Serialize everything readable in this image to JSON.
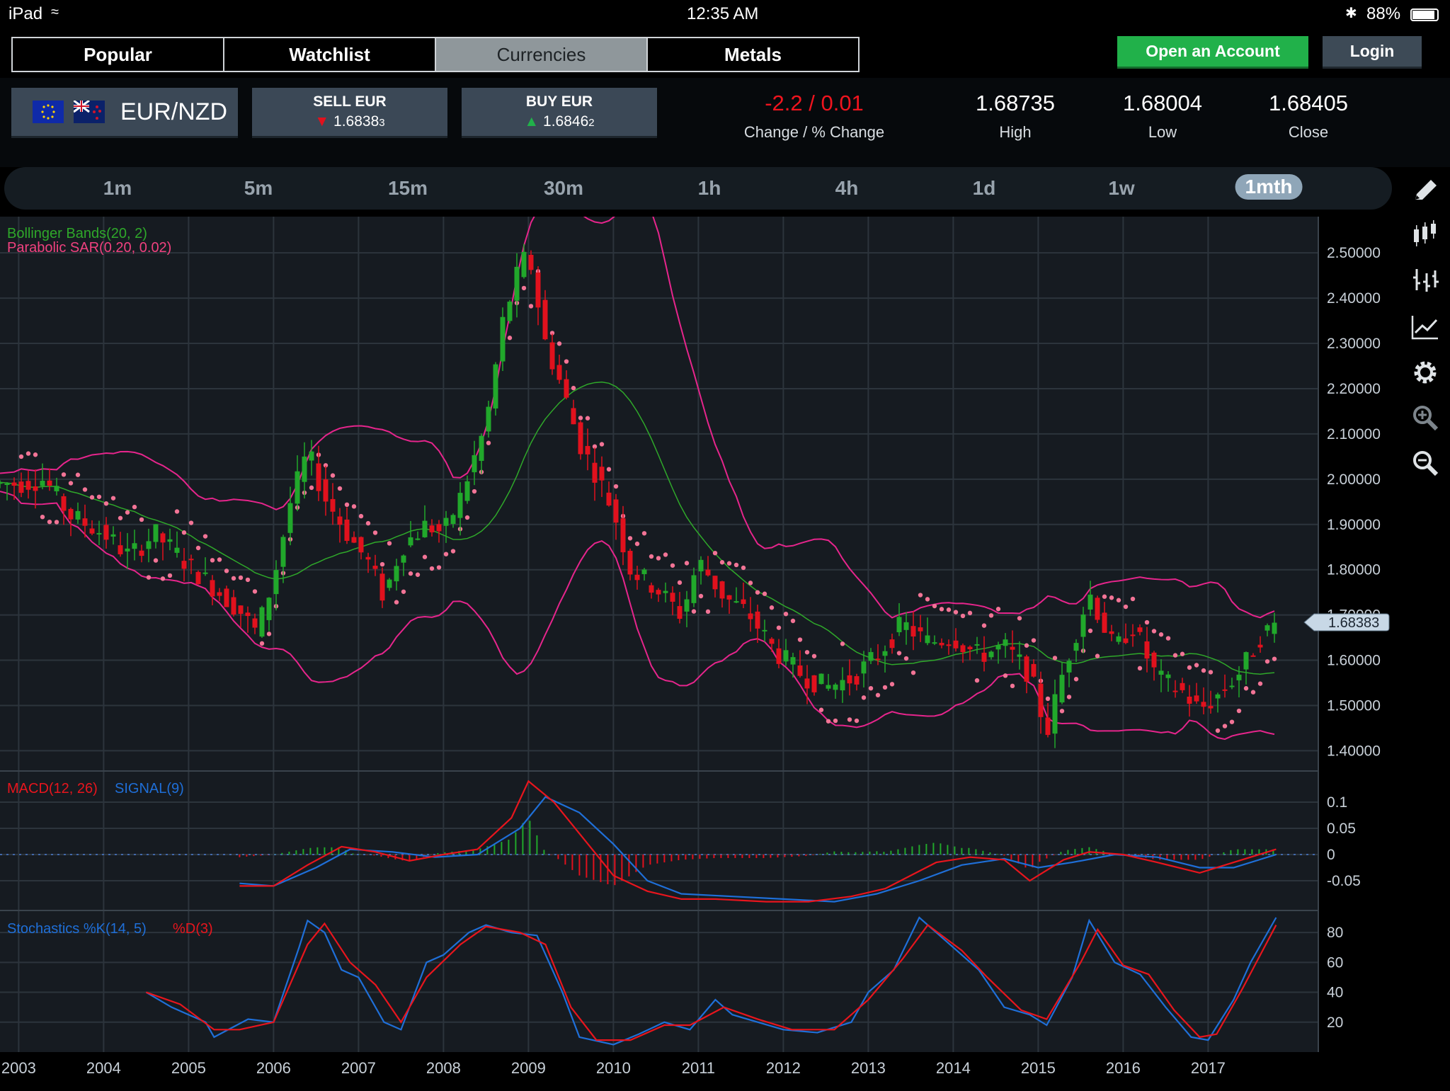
{
  "status_bar": {
    "device": "iPad",
    "time": "12:35 AM",
    "battery": "88%"
  },
  "nav_tabs": [
    {
      "label": "Popular",
      "active": false
    },
    {
      "label": "Watchlist",
      "active": false
    },
    {
      "label": "Currencies",
      "active": true
    },
    {
      "label": "Metals",
      "active": false
    }
  ],
  "account": {
    "open_label": "Open an Account",
    "login_label": "Login"
  },
  "instrument": {
    "pair": "EUR/NZD",
    "flags": [
      "eu-flag-icon",
      "nz-flag-icon"
    ]
  },
  "sell": {
    "label": "SELL EUR",
    "price": "1.6838",
    "price_small": "3"
  },
  "buy": {
    "label": "BUY EUR",
    "price": "1.6846",
    "price_small": "2"
  },
  "stats": {
    "change": {
      "value": "-2.2 / 0.01",
      "label": "Change / % Change"
    },
    "high": {
      "value": "1.68735",
      "label": "High"
    },
    "low": {
      "value": "1.68004",
      "label": "Low"
    },
    "close": {
      "value": "1.68405",
      "label": "Close"
    }
  },
  "timeframes": [
    "1m",
    "5m",
    "15m",
    "30m",
    "1h",
    "4h",
    "1d",
    "1w",
    "1mth"
  ],
  "active_timeframe": "1mth",
  "tools": [
    "pencil-icon",
    "candlestick-icon",
    "ohlc-bars-icon",
    "line-chart-icon",
    "gear-icon",
    "zoom-in-icon",
    "zoom-out-icon"
  ],
  "colors": {
    "up": "#21a82b",
    "down": "#e1111d",
    "bollinger": "#e6258c",
    "bollinger_mid": "#2fa82a",
    "sar": "#f27496",
    "macd": "#e8151d",
    "signal": "#1f6fd8",
    "grid": "#2c343c",
    "accent_green": "#21b14a"
  },
  "chart_data": {
    "type": "candlestick",
    "indicators_label": {
      "bollinger": "Bollinger Bands(20, 2)",
      "sar": "Parabolic SAR(0.20, 0.02)"
    },
    "x_ticks": [
      "2003",
      "2004",
      "2005",
      "2006",
      "2007",
      "2008",
      "2009",
      "2010",
      "2011",
      "2012",
      "2013",
      "2014",
      "2015",
      "2016",
      "2017"
    ],
    "y_ticks": [
      "2.50000",
      "2.40000",
      "2.30000",
      "2.20000",
      "2.10000",
      "2.00000",
      "1.90000",
      "1.80000",
      "1.70000",
      "1.60000",
      "1.50000",
      "1.40000"
    ],
    "ylim": [
      1.36,
      2.58
    ],
    "current_price": "1.68383",
    "price_path": [
      [
        2003.0,
        1.99
      ],
      [
        2003.3,
        2.0
      ],
      [
        2003.6,
        1.92
      ],
      [
        2004.0,
        1.88
      ],
      [
        2004.3,
        1.83
      ],
      [
        2004.6,
        1.88
      ],
      [
        2005.0,
        1.81
      ],
      [
        2005.3,
        1.76
      ],
      [
        2005.6,
        1.71
      ],
      [
        2005.8,
        1.66
      ],
      [
        2006.0,
        1.78
      ],
      [
        2006.2,
        1.95
      ],
      [
        2006.4,
        2.06
      ],
      [
        2006.6,
        1.96
      ],
      [
        2006.9,
        1.87
      ],
      [
        2007.1,
        1.82
      ],
      [
        2007.3,
        1.74
      ],
      [
        2007.5,
        1.85
      ],
      [
        2007.8,
        1.9
      ],
      [
        2008.0,
        1.88
      ],
      [
        2008.2,
        1.96
      ],
      [
        2008.5,
        2.12
      ],
      [
        2008.7,
        2.35
      ],
      [
        2008.9,
        2.47
      ],
      [
        2009.0,
        2.5
      ],
      [
        2009.2,
        2.3
      ],
      [
        2009.4,
        2.2
      ],
      [
        2009.6,
        2.08
      ],
      [
        2009.8,
        2.01
      ],
      [
        2010.0,
        1.93
      ],
      [
        2010.2,
        1.8
      ],
      [
        2010.5,
        1.76
      ],
      [
        2010.8,
        1.7
      ],
      [
        2011.0,
        1.82
      ],
      [
        2011.3,
        1.74
      ],
      [
        2011.6,
        1.7
      ],
      [
        2011.9,
        1.62
      ],
      [
        2012.2,
        1.57
      ],
      [
        2012.5,
        1.54
      ],
      [
        2012.8,
        1.56
      ],
      [
        2013.1,
        1.61
      ],
      [
        2013.4,
        1.68
      ],
      [
        2013.7,
        1.64
      ],
      [
        2014.0,
        1.65
      ],
      [
        2014.3,
        1.61
      ],
      [
        2014.6,
        1.63
      ],
      [
        2014.9,
        1.57
      ],
      [
        2015.1,
        1.44
      ],
      [
        2015.3,
        1.58
      ],
      [
        2015.6,
        1.75
      ],
      [
        2015.9,
        1.62
      ],
      [
        2016.1,
        1.68
      ],
      [
        2016.4,
        1.56
      ],
      [
        2016.7,
        1.53
      ],
      [
        2016.9,
        1.49
      ],
      [
        2017.1,
        1.52
      ],
      [
        2017.4,
        1.58
      ],
      [
        2017.6,
        1.65
      ],
      [
        2017.8,
        1.68
      ]
    ],
    "macd_label": {
      "macd": "MACD(12, 26)",
      "signal": "SIGNAL(9)"
    },
    "macd_ticks": [
      "0.1",
      "0.05",
      "0",
      "-0.05"
    ],
    "macd_ylim": [
      -0.1,
      0.15
    ],
    "macd": [
      [
        2005.6,
        -0.06
      ],
      [
        2006.0,
        -0.06
      ],
      [
        2006.4,
        -0.02
      ],
      [
        2006.8,
        0.015
      ],
      [
        2007.2,
        0.005
      ],
      [
        2007.6,
        -0.012
      ],
      [
        2008.0,
        0.0
      ],
      [
        2008.4,
        0.01
      ],
      [
        2008.8,
        0.07
      ],
      [
        2009.0,
        0.14
      ],
      [
        2009.3,
        0.1
      ],
      [
        2009.7,
        0.02
      ],
      [
        2010.0,
        -0.04
      ],
      [
        2010.4,
        -0.07
      ],
      [
        2010.8,
        -0.085
      ],
      [
        2011.2,
        -0.085
      ],
      [
        2011.8,
        -0.09
      ],
      [
        2012.3,
        -0.09
      ],
      [
        2012.8,
        -0.08
      ],
      [
        2013.2,
        -0.065
      ],
      [
        2013.8,
        -0.015
      ],
      [
        2014.2,
        -0.005
      ],
      [
        2014.6,
        -0.01
      ],
      [
        2014.9,
        -0.05
      ],
      [
        2015.3,
        -0.01
      ],
      [
        2015.6,
        0.005
      ],
      [
        2016.0,
        0.0
      ],
      [
        2016.4,
        -0.015
      ],
      [
        2016.9,
        -0.035
      ],
      [
        2017.3,
        -0.015
      ],
      [
        2017.8,
        0.01
      ]
    ],
    "signal": [
      [
        2005.6,
        -0.055
      ],
      [
        2006.0,
        -0.06
      ],
      [
        2006.5,
        -0.025
      ],
      [
        2006.9,
        0.01
      ],
      [
        2007.4,
        0.005
      ],
      [
        2007.9,
        -0.005
      ],
      [
        2008.4,
        0.0
      ],
      [
        2008.9,
        0.05
      ],
      [
        2009.2,
        0.11
      ],
      [
        2009.6,
        0.08
      ],
      [
        2010.0,
        0.02
      ],
      [
        2010.4,
        -0.05
      ],
      [
        2010.8,
        -0.075
      ],
      [
        2011.4,
        -0.08
      ],
      [
        2012.0,
        -0.085
      ],
      [
        2012.6,
        -0.09
      ],
      [
        2013.1,
        -0.075
      ],
      [
        2013.6,
        -0.05
      ],
      [
        2014.1,
        -0.02
      ],
      [
        2014.6,
        -0.008
      ],
      [
        2015.0,
        -0.025
      ],
      [
        2015.4,
        -0.015
      ],
      [
        2015.9,
        0.0
      ],
      [
        2016.4,
        -0.005
      ],
      [
        2016.9,
        -0.025
      ],
      [
        2017.3,
        -0.025
      ],
      [
        2017.8,
        0.0
      ]
    ],
    "stoch_label": {
      "k": "Stochastics %K(14, 5)",
      "d": "%D(3)"
    },
    "stoch_ticks": [
      "80",
      "60",
      "40",
      "20"
    ],
    "stoch_ylim": [
      0,
      90
    ],
    "stoch_k": [
      [
        2004.5,
        40
      ],
      [
        2004.8,
        30
      ],
      [
        2005.2,
        20
      ],
      [
        2005.3,
        10
      ],
      [
        2005.7,
        22
      ],
      [
        2006.0,
        20
      ],
      [
        2006.3,
        70
      ],
      [
        2006.4,
        88
      ],
      [
        2006.6,
        80
      ],
      [
        2006.8,
        55
      ],
      [
        2007.0,
        50
      ],
      [
        2007.3,
        20
      ],
      [
        2007.5,
        15
      ],
      [
        2007.8,
        60
      ],
      [
        2008.0,
        65
      ],
      [
        2008.3,
        80
      ],
      [
        2008.5,
        85
      ],
      [
        2008.8,
        80
      ],
      [
        2009.1,
        78
      ],
      [
        2009.4,
        40
      ],
      [
        2009.6,
        10
      ],
      [
        2010.0,
        5
      ],
      [
        2010.3,
        12
      ],
      [
        2010.6,
        20
      ],
      [
        2010.9,
        15
      ],
      [
        2011.2,
        35
      ],
      [
        2011.4,
        25
      ],
      [
        2011.7,
        20
      ],
      [
        2012.0,
        15
      ],
      [
        2012.4,
        13
      ],
      [
        2012.8,
        20
      ],
      [
        2013.0,
        40
      ],
      [
        2013.3,
        55
      ],
      [
        2013.6,
        90
      ],
      [
        2014.0,
        70
      ],
      [
        2014.3,
        55
      ],
      [
        2014.6,
        30
      ],
      [
        2014.9,
        25
      ],
      [
        2015.1,
        18
      ],
      [
        2015.4,
        50
      ],
      [
        2015.6,
        88
      ],
      [
        2015.9,
        60
      ],
      [
        2016.2,
        52
      ],
      [
        2016.5,
        30
      ],
      [
        2016.8,
        10
      ],
      [
        2017.0,
        8
      ],
      [
        2017.3,
        35
      ],
      [
        2017.5,
        60
      ],
      [
        2017.8,
        90
      ]
    ],
    "stoch_d": [
      [
        2004.5,
        40
      ],
      [
        2004.9,
        32
      ],
      [
        2005.3,
        15
      ],
      [
        2005.6,
        15
      ],
      [
        2006.0,
        20
      ],
      [
        2006.4,
        72
      ],
      [
        2006.6,
        86
      ],
      [
        2006.9,
        60
      ],
      [
        2007.2,
        45
      ],
      [
        2007.5,
        20
      ],
      [
        2007.8,
        50
      ],
      [
        2008.2,
        72
      ],
      [
        2008.5,
        84
      ],
      [
        2008.9,
        80
      ],
      [
        2009.2,
        72
      ],
      [
        2009.5,
        30
      ],
      [
        2009.8,
        8
      ],
      [
        2010.2,
        8
      ],
      [
        2010.6,
        18
      ],
      [
        2010.9,
        18
      ],
      [
        2011.3,
        30
      ],
      [
        2011.7,
        22
      ],
      [
        2012.1,
        15
      ],
      [
        2012.6,
        15
      ],
      [
        2013.0,
        35
      ],
      [
        2013.4,
        62
      ],
      [
        2013.7,
        85
      ],
      [
        2014.1,
        68
      ],
      [
        2014.4,
        50
      ],
      [
        2014.8,
        28
      ],
      [
        2015.1,
        22
      ],
      [
        2015.5,
        60
      ],
      [
        2015.7,
        82
      ],
      [
        2016.0,
        58
      ],
      [
        2016.3,
        52
      ],
      [
        2016.6,
        28
      ],
      [
        2016.9,
        10
      ],
      [
        2017.1,
        12
      ],
      [
        2017.4,
        42
      ],
      [
        2017.8,
        85
      ]
    ]
  }
}
